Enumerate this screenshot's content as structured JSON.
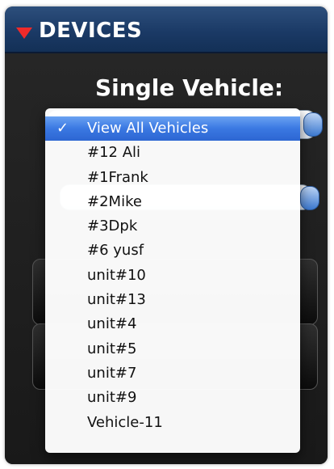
{
  "window": {
    "title": "DEVICES",
    "title_icon": "triangle-down-icon",
    "title_bar_color": "#1b3a66",
    "triangle_color": "#ef2a2a"
  },
  "panel": {
    "section_label": "Single Vehicle:"
  },
  "dropdown": {
    "selected_index": 0,
    "check_mark": "✓",
    "highlight_color": "#3a78e2",
    "items": [
      {
        "label": "View All Vehicles",
        "checked": true
      },
      {
        "label": "#12 Ali",
        "checked": false
      },
      {
        "label": "#1Frank",
        "checked": false
      },
      {
        "label": "#2Mike",
        "checked": false
      },
      {
        "label": "#3Dpk",
        "checked": false
      },
      {
        "label": "#6 yusf",
        "checked": false
      },
      {
        "label": "unit#10",
        "checked": false
      },
      {
        "label": "unit#13",
        "checked": false
      },
      {
        "label": "unit#4",
        "checked": false
      },
      {
        "label": "unit#5",
        "checked": false
      },
      {
        "label": "unit#7",
        "checked": false
      },
      {
        "label": "unit#9",
        "checked": false
      },
      {
        "label": "Vehicle-11",
        "checked": false
      }
    ]
  }
}
